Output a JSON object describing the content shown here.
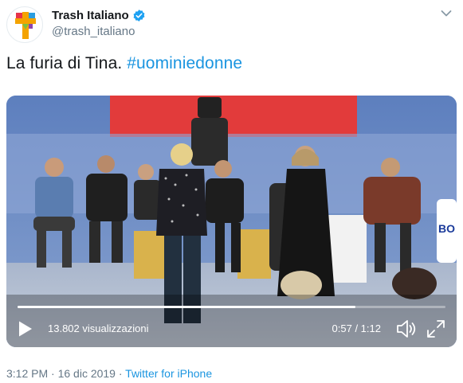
{
  "author": {
    "display_name": "Trash Italiano",
    "handle": "@trash_italiano",
    "verified": true
  },
  "tweet": {
    "text": "La furia di Tina.",
    "hashtag": "#uominiedonne"
  },
  "video": {
    "views": "13.802 visualizzazioni",
    "time": "0:57 / 1:12",
    "progress": 0.79,
    "scene_sign": "BO"
  },
  "footer": {
    "timestamp": "3:12 PM · 16 dic 2019 · ",
    "source": "Twitter for iPhone"
  },
  "colors": {
    "link": "#1b95e0",
    "verified": "#1da1f2",
    "secondary_text": "#657786"
  },
  "icons": [
    "logo-icon",
    "verified-icon",
    "chevron-down-icon",
    "play-icon",
    "volume-icon",
    "fullscreen-icon"
  ]
}
